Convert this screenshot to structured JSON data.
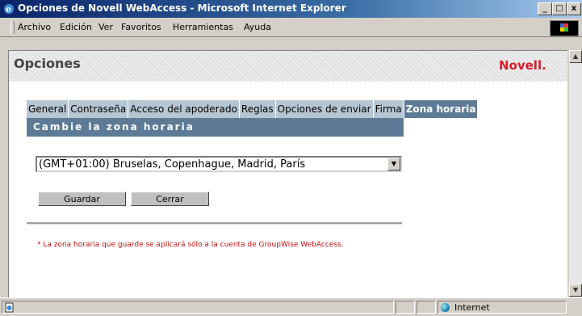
{
  "window": {
    "title": "Opciones de Novell WebAccess - Microsoft Internet Explorer",
    "controls": {
      "minimize": "_",
      "restore": "□",
      "close": "x"
    }
  },
  "menu": [
    "Archivo",
    "Edición",
    "Ver",
    "Favoritos",
    "Herramientas",
    "Ayuda"
  ],
  "header": {
    "title": "Opciones",
    "logo": "Novell."
  },
  "tabs": [
    {
      "label": "General",
      "active": false
    },
    {
      "label": "Contraseña",
      "active": false
    },
    {
      "label": "Acceso del apoderado",
      "active": false
    },
    {
      "label": "Reglas",
      "active": false
    },
    {
      "label": "Opciones de enviar",
      "active": false
    },
    {
      "label": "Firma",
      "active": false
    },
    {
      "label": "Zona horaria",
      "active": true
    }
  ],
  "section": {
    "title": "Cambie la zona horaria"
  },
  "timezone": {
    "selected": "(GMT+01:00) Bruselas, Copenhague, Madrid, París"
  },
  "buttons": {
    "save": "Guardar",
    "close": "Cerrar"
  },
  "note": "* La zona horaria que guarde se aplicará sólo a la cuenta de GroupWise WebAccess.",
  "status": {
    "zone": "Internet"
  },
  "colors": {
    "accent": "#5d7b96",
    "tab": "#b7c6d3",
    "brand": "#d71e2b",
    "note": "#c01010"
  },
  "icons": {
    "app": "ie-icon",
    "status_page": "page-icon",
    "zone": "globe-icon"
  }
}
